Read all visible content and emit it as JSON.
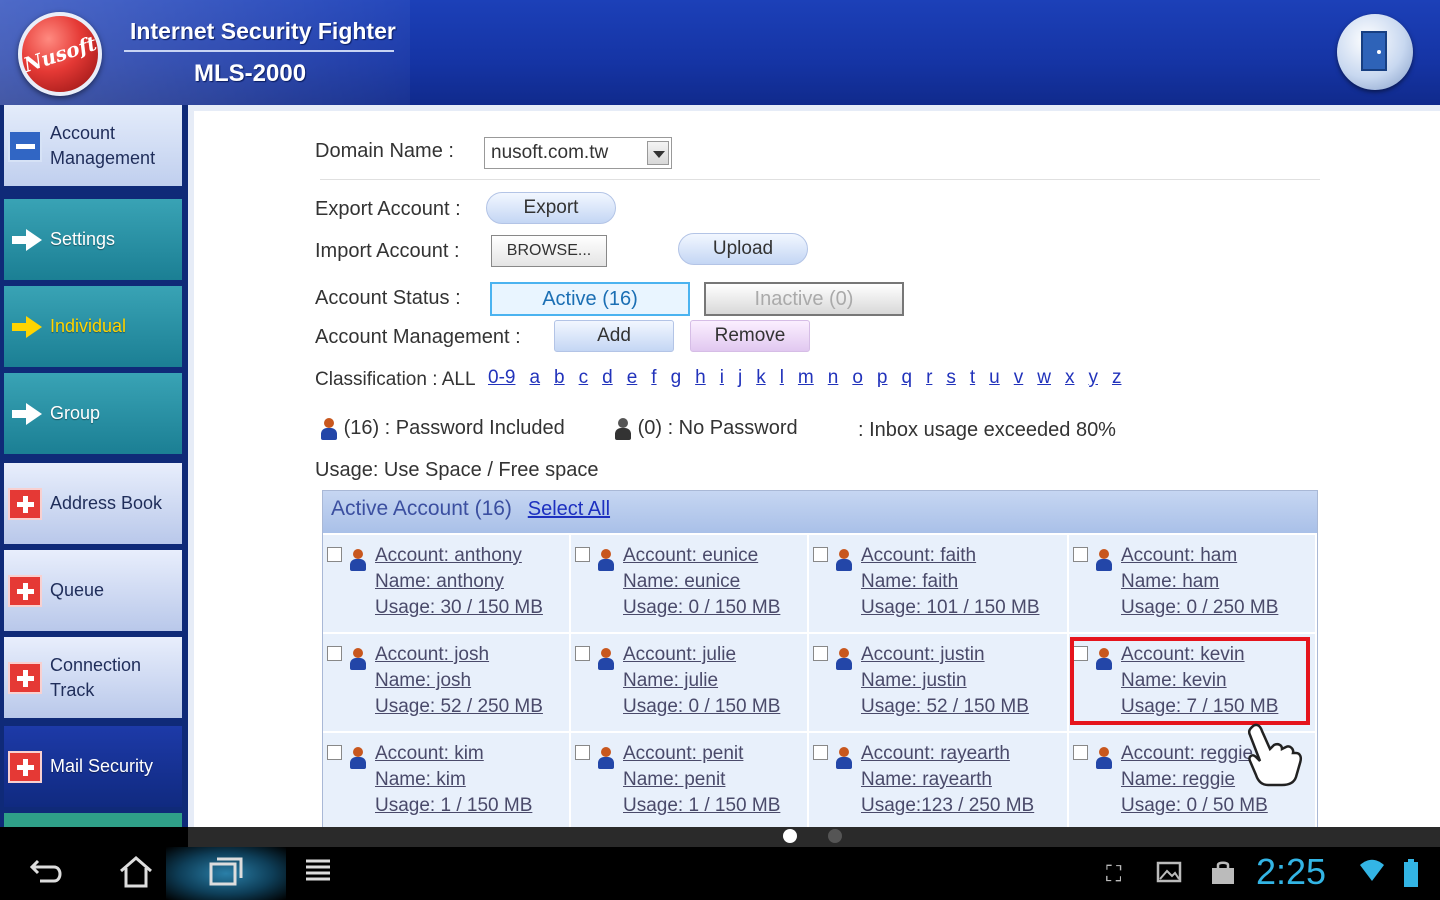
{
  "header": {
    "title": "Internet Security Fighter",
    "model": "MLS-2000",
    "logo_text": "Nusoft",
    "logout_icon": "door-exit-icon"
  },
  "sidebar": {
    "items": [
      {
        "label": "Account Management",
        "icon": "minus-icon",
        "style": "light"
      },
      {
        "label": "Settings",
        "icon": "arrow-right-icon",
        "style": "teal"
      },
      {
        "label": "Individual",
        "icon": "arrow-right-icon",
        "style": "teal",
        "active": true
      },
      {
        "label": "Group",
        "icon": "arrow-right-icon",
        "style": "teal"
      },
      {
        "label": "Address Book",
        "icon": "plus-icon",
        "style": "light"
      },
      {
        "label": "Queue",
        "icon": "plus-icon",
        "style": "light"
      },
      {
        "label": "Connection Track",
        "icon": "plus-icon",
        "style": "light"
      },
      {
        "label": "Mail Security",
        "icon": "plus-icon",
        "style": "dark"
      }
    ]
  },
  "form": {
    "domain_label": "Domain Name :",
    "domain_value": "nusoft.com.tw",
    "export_label": "Export Account :",
    "export_button": "Export",
    "import_label": "Import Account :",
    "browse_button": "BROWSE...",
    "upload_button": "Upload",
    "status_label": "Account Status :",
    "status_active": "Active (16)",
    "status_inactive": "Inactive (0)",
    "management_label": "Account Management :",
    "add_button": "Add",
    "remove_button": "Remove",
    "classification_label": "Classification : ALL",
    "classification_letters": [
      "0-9",
      "a",
      "b",
      "c",
      "d",
      "e",
      "f",
      "g",
      "h",
      "i",
      "j",
      "k",
      "l",
      "m",
      "n",
      "o",
      "p",
      "q",
      "r",
      "s",
      "t",
      "u",
      "v",
      "w",
      "x",
      "y",
      "z"
    ]
  },
  "legend": {
    "password_included": "(16) : Password Included",
    "no_password": "(0) : No Password",
    "inbox_exceeded": ": Inbox usage exceeded 80%",
    "usage_note": "Usage: Use Space / Free space"
  },
  "accounts_table": {
    "title": "Active Account (16)",
    "select_all": "Select All",
    "rows": [
      [
        {
          "account": "Account: anthony",
          "name": "Name: anthony",
          "usage": "Usage: 30 / 150 MB"
        },
        {
          "account": "Account: eunice",
          "name": "Name: eunice",
          "usage": "Usage: 0 / 150 MB"
        },
        {
          "account": "Account: faith",
          "name": "Name: faith",
          "usage": "Usage: 101 / 150 MB"
        },
        {
          "account": "Account: ham",
          "name": "Name: ham",
          "usage": "Usage: 0 / 250 MB"
        }
      ],
      [
        {
          "account": "Account: josh",
          "name": "Name: josh",
          "usage": "Usage: 52 / 250 MB"
        },
        {
          "account": "Account: julie",
          "name": "Name: julie",
          "usage": "Usage: 0 / 150 MB"
        },
        {
          "account": "Account: justin",
          "name": "Name: justin",
          "usage": "Usage: 52 / 150 MB"
        },
        {
          "account": "Account: kevin",
          "name": "Name: kevin",
          "usage": "Usage: 7 / 150 MB"
        }
      ],
      [
        {
          "account": "Account: kim",
          "name": "Name: kim",
          "usage": "Usage: 1 / 150 MB"
        },
        {
          "account": "Account: penit",
          "name": "Name: penit",
          "usage": "Usage: 1 / 150 MB"
        },
        {
          "account": "Account: rayearth",
          "name": "Name: rayearth",
          "usage": "Usage:123 / 250 MB"
        },
        {
          "account": "Account: reggie",
          "name": "Name: reggie",
          "usage": "Usage: 0 / 50 MB"
        }
      ]
    ]
  },
  "system_bar": {
    "time": "2:25",
    "nav_icons": [
      "back-icon",
      "home-icon",
      "recents-icon",
      "menu-icon"
    ],
    "status_icons": [
      "screenshot-icon",
      "gallery-icon",
      "shopping-bag-icon",
      "wifi-icon",
      "battery-icon"
    ]
  },
  "colors": {
    "header_blue": "#1534a4",
    "sidebar_teal": "#1b7f94",
    "highlight_red": "#e5141c",
    "link_blue": "#2233bb",
    "clock_blue": "#33b5e5"
  }
}
